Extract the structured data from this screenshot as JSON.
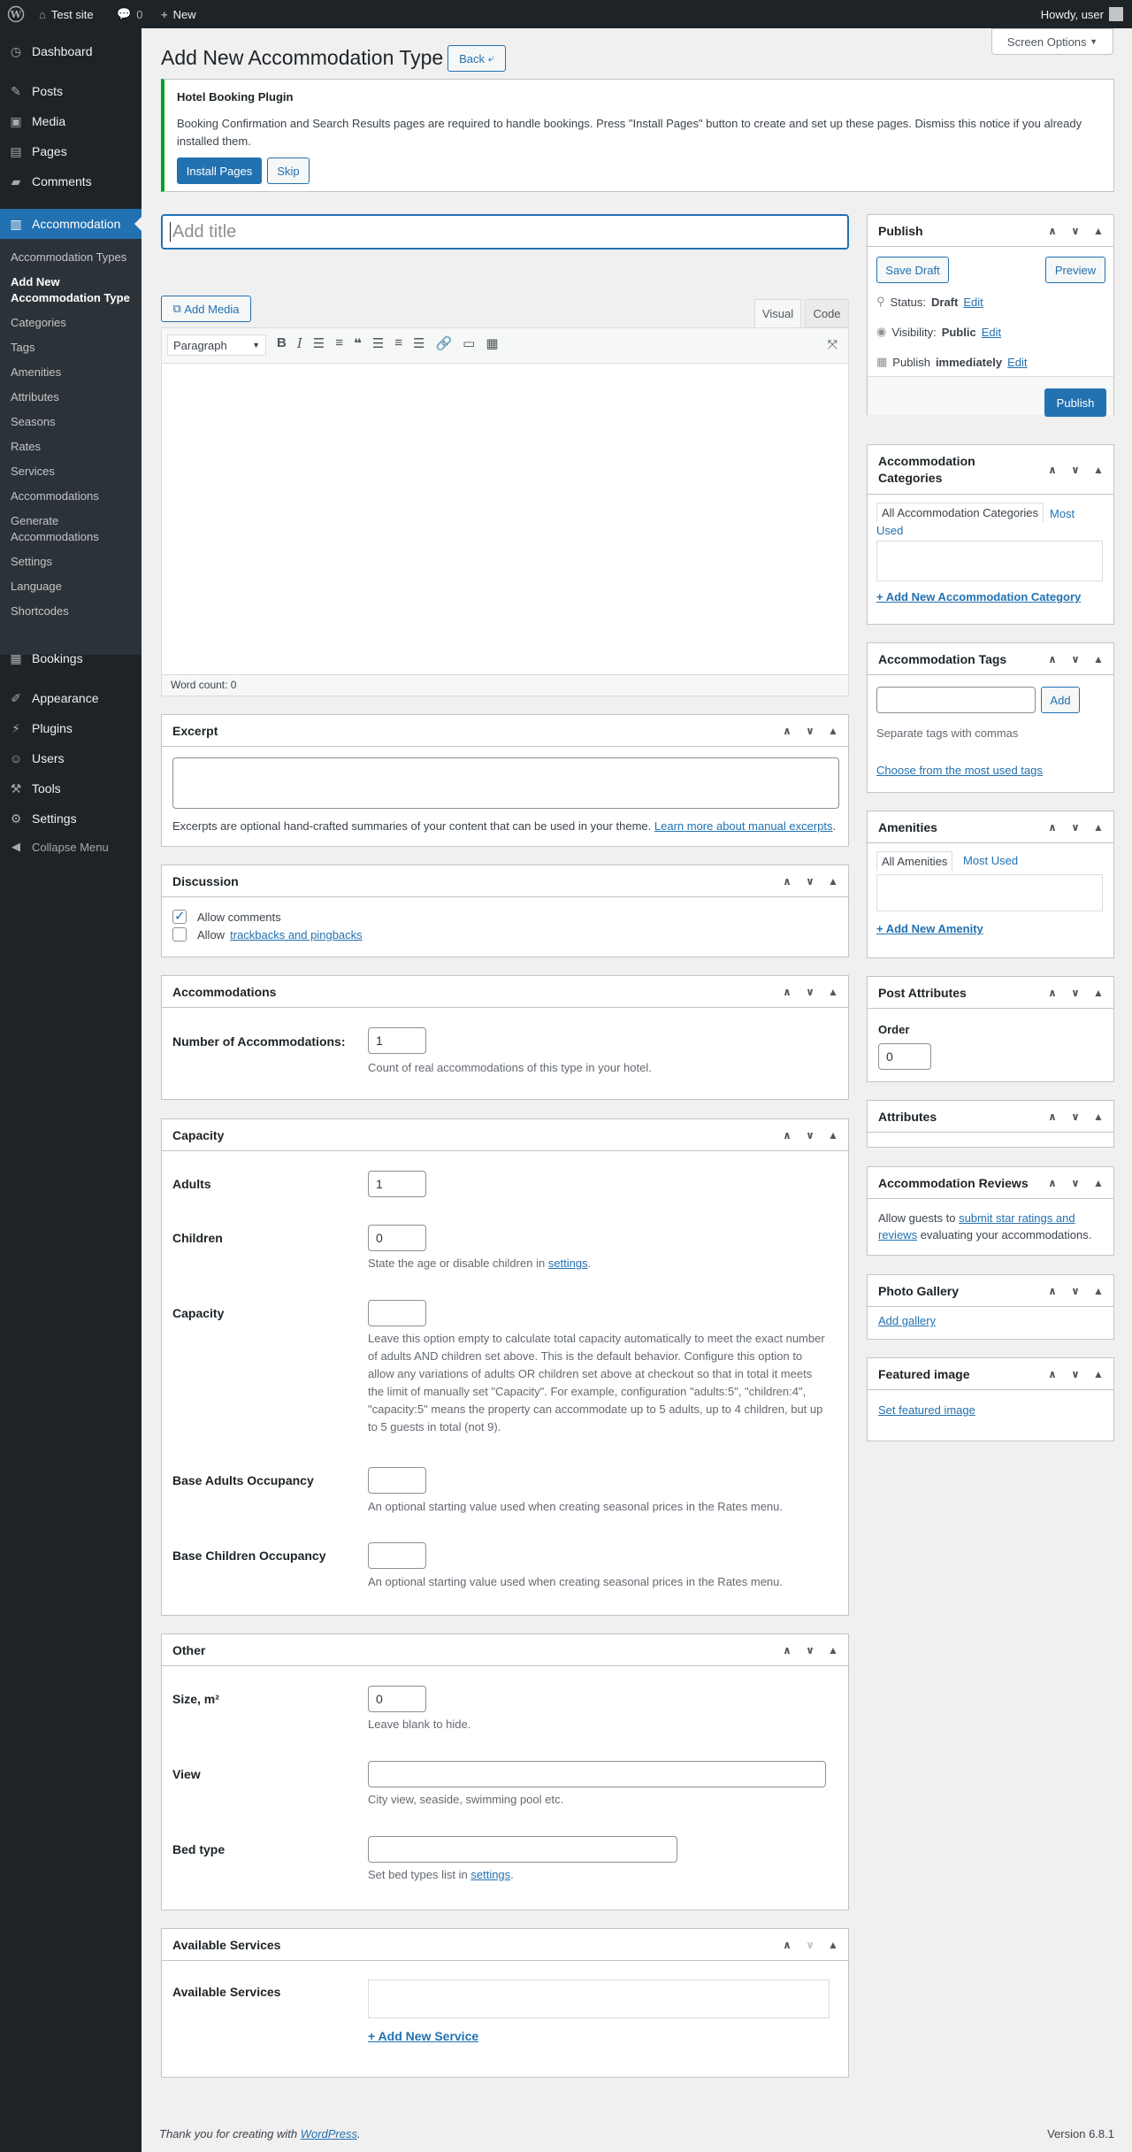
{
  "adminbar": {
    "site": "Test site",
    "comments": "0",
    "new": "New",
    "howdy": "Howdy, user"
  },
  "menu": {
    "dashboard": "Dashboard",
    "posts": "Posts",
    "media": "Media",
    "pages": "Pages",
    "comments": "Comments",
    "accommodation": "Accommodation",
    "sub": [
      "Accommodation Types",
      "Add New Accommodation Type",
      "Categories",
      "Tags",
      "Amenities",
      "Attributes",
      "Seasons",
      "Rates",
      "Services",
      "Accommodations",
      "Generate Accommodations",
      "Settings",
      "Language",
      "Shortcodes"
    ],
    "bookings": "Bookings",
    "appearance": "Appearance",
    "plugins": "Plugins",
    "users": "Users",
    "tools": "Tools",
    "settings": "Settings",
    "collapse": "Collapse Menu"
  },
  "screen_options": "Screen Options",
  "page": {
    "title": "Add New Accommodation Type",
    "back": "Back"
  },
  "notice": {
    "title": "Hotel Booking Plugin",
    "text": "Booking Confirmation and Search Results pages are required to handle bookings. Press \"Install Pages\" button to create and set up these pages. Dismiss this notice if you already installed them.",
    "install": "Install Pages",
    "skip": "Skip"
  },
  "editor": {
    "title_placeholder": "Add title",
    "add_media": "Add Media",
    "tab_visual": "Visual",
    "tab_code": "Code",
    "format": "Paragraph",
    "word_count": "Word count: 0"
  },
  "excerpt": {
    "title": "Excerpt",
    "help": "Excerpts are optional hand-crafted summaries of your content that can be used in your theme.",
    "link": "Learn more about manual excerpts"
  },
  "discussion": {
    "title": "Discussion",
    "allow_comments": "Allow comments",
    "allow": "Allow",
    "trackbacks": "trackbacks and pingbacks"
  },
  "accommodations": {
    "title": "Accommodations",
    "label": "Number of Accommodations:",
    "value": "1",
    "desc": "Count of real accommodations of this type in your hotel."
  },
  "capacity": {
    "title": "Capacity",
    "adults_label": "Adults",
    "adults": "1",
    "children_label": "Children",
    "children": "0",
    "children_desc": "State the age or disable children in",
    "settings_link": "settings",
    "capacity_label": "Capacity",
    "capacity_desc": "Leave this option empty to calculate total capacity automatically to meet the exact number of adults AND children set above. This is the default behavior. Configure this option to allow any variations of adults OR children set above at checkout so that in total it meets the limit of manually set \"Capacity\". For example, configuration \"adults:5\", \"children:4\", \"capacity:5\" means the property can accommodate up to 5 adults, up to 4 children, but up to 5 guests in total (not 9).",
    "base_adults_label": "Base Adults Occupancy",
    "base_adults_desc": "An optional starting value used when creating seasonal prices in the Rates menu.",
    "base_children_label": "Base Children Occupancy",
    "base_children_desc": "An optional starting value used when creating seasonal prices in the Rates menu."
  },
  "other": {
    "title": "Other",
    "size_label": "Size, m²",
    "size": "0",
    "size_desc": "Leave blank to hide.",
    "view_label": "View",
    "view_desc": "City view, seaside, swimming pool etc.",
    "bed_label": "Bed type",
    "bed_desc": "Set bed types list in",
    "settings_link": "settings"
  },
  "services": {
    "title": "Available Services",
    "label": "Available Services",
    "add": "+ Add New Service"
  },
  "publish": {
    "title": "Publish",
    "save_draft": "Save Draft",
    "preview": "Preview",
    "status_label": "Status:",
    "status": "Draft",
    "visibility_label": "Visibility:",
    "visibility": "Public",
    "publish_label": "Publish",
    "publish_when": "immediately",
    "edit": "Edit",
    "publish_btn": "Publish"
  },
  "categories": {
    "title": "Accommodation Categories",
    "tab_all": "All Accommodation Categories",
    "tab_most": "Most Used",
    "add": "+ Add New Accommodation Category"
  },
  "tags": {
    "title": "Accommodation Tags",
    "add": "Add",
    "help": "Separate tags with commas",
    "choose": "Choose from the most used tags"
  },
  "amenities": {
    "title": "Amenities",
    "tab_all": "All Amenities",
    "tab_most": "Most Used",
    "add": "+ Add New Amenity"
  },
  "post_attributes": {
    "title": "Post Attributes",
    "order_label": "Order",
    "order": "0"
  },
  "attributes": {
    "title": "Attributes"
  },
  "reviews": {
    "title": "Accommodation Reviews",
    "pre": "Allow guests to",
    "link": "submit star ratings and reviews",
    "post": "evaluating your accommodations."
  },
  "gallery": {
    "title": "Photo Gallery",
    "add": "Add gallery"
  },
  "featured": {
    "title": "Featured image",
    "set": "Set featured image"
  },
  "footer": {
    "thanks": "Thank you for creating with",
    "wp": "WordPress",
    "version": "Version 6.8.1"
  }
}
